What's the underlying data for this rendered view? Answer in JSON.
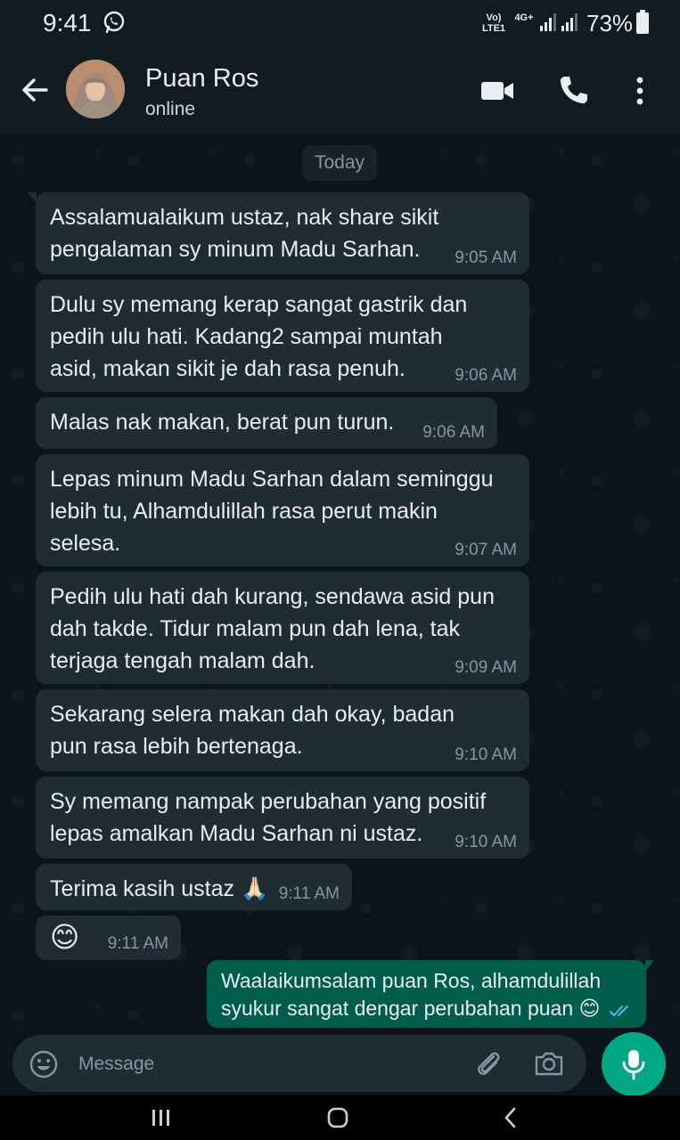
{
  "status_bar": {
    "time": "9:41",
    "network_volte": "Vo)\nLTE1",
    "network_type": "4G+",
    "battery_percent": "73%",
    "icons": [
      "whatsapp-icon",
      "signal-icon",
      "signal-icon",
      "battery-icon"
    ]
  },
  "header": {
    "contact_name": "Puan Ros",
    "contact_status": "online",
    "icons": [
      "back-arrow-icon",
      "video-call-icon",
      "voice-call-icon",
      "more-vert-icon"
    ]
  },
  "chat": {
    "date_chip": "Today",
    "messages": [
      {
        "direction": "in",
        "text": "Assalamualaikum ustaz, nak share sikit\npengalaman sy minum Madu Sarhan.",
        "time": "9:05 AM"
      },
      {
        "direction": "in",
        "text": "Dulu sy memang kerap sangat gastrik dan\npedih ulu hati. Kadang2 sampai muntah\nasid, makan sikit je dah rasa penuh.",
        "time": "9:06 AM"
      },
      {
        "direction": "in",
        "text": "Malas nak makan, berat pun turun.",
        "time": "9:06 AM"
      },
      {
        "direction": "in",
        "text": "Lepas minum Madu Sarhan dalam seminggu\nlebih tu, Alhamdulillah rasa perut makin\nselesa.",
        "time": "9:07 AM"
      },
      {
        "direction": "in",
        "text": "Pedih ulu hati dah kurang, sendawa asid pun\ndah takde. Tidur malam pun dah lena, tak\nterjaga tengah malam dah.",
        "time": "9:09 AM"
      },
      {
        "direction": "in",
        "text": "Sekarang selera makan dah okay, badan\npun rasa lebih bertenaga.",
        "time": "9:10 AM"
      },
      {
        "direction": "in",
        "text": "Sy memang nampak perubahan yang positif\nlepas amalkan Madu Sarhan ni ustaz.",
        "time": "9:10 AM"
      },
      {
        "direction": "in",
        "text": "Terima kasih ustaz 🙏🏻",
        "time": "9:11 AM"
      },
      {
        "direction": "in",
        "text": "😊",
        "time": "9:11 AM"
      },
      {
        "direction": "out",
        "text": "Waalaikumsalam puan Ros, alhamdulillah\nsyukur sangat dengar perubahan puan 😊",
        "time": "",
        "status": "read"
      }
    ]
  },
  "input_bar": {
    "placeholder": "Message",
    "icons": [
      "emoji-icon",
      "attach-icon",
      "camera-icon",
      "mic-icon"
    ]
  },
  "nav_bar": {
    "icons": [
      "recent-apps-icon",
      "home-icon",
      "back-nav-icon"
    ]
  },
  "colors": {
    "background": "#0b141a",
    "header": "#111b21",
    "incoming_bubble": "#202c33",
    "outgoing_bubble": "#005c4b",
    "accent": "#00a884",
    "read_ticks": "#53bdeb"
  }
}
